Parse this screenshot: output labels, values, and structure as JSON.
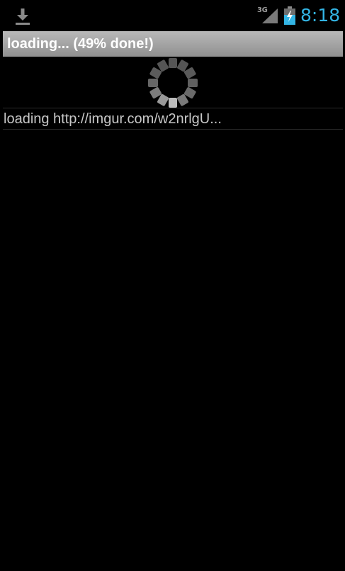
{
  "status_bar": {
    "clock": "8:18",
    "network_type": "3G",
    "icons": {
      "notification": "download-icon",
      "signal": "signal-icon",
      "battery": "battery-charging-icon"
    },
    "colors": {
      "clock": "#33b5e5",
      "battery_fill": "#33b5e5"
    }
  },
  "progress": {
    "title": "loading... (49% done!)",
    "percent": 49
  },
  "list": {
    "items": [
      {
        "text": "loading http://imgur.com/w2nrlgU..."
      }
    ]
  }
}
